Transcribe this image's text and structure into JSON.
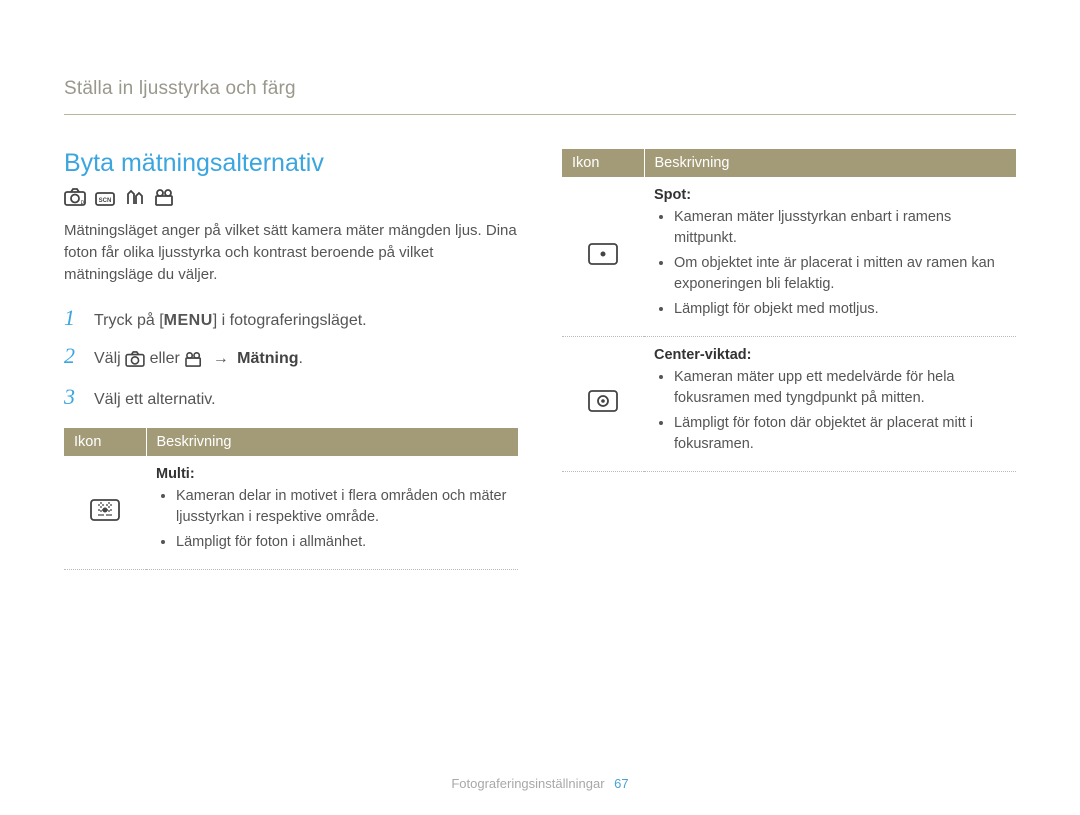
{
  "breadcrumb": "Ställa in ljusstyrka och färg",
  "title": "Byta mätningsalternativ",
  "intro": "Mätningsläget anger på vilket sätt kamera mäter mängden ljus. Dina foton får olika ljusstyrka och kontrast beroende på vilket mätningsläge du väljer.",
  "steps": {
    "s1_prefix": "Tryck på [",
    "s1_menu": "MENU",
    "s1_suffix": "] i fotograferingsläget.",
    "s2_prefix": "Välj ",
    "s2_mid": " eller ",
    "s2_arrow": "→",
    "s2_label": "Mätning",
    "s2_suffix": ".",
    "s3": "Välj ett alternativ."
  },
  "table": {
    "headers": {
      "icon": "Ikon",
      "desc": "Beskrivning"
    },
    "rows": {
      "multi": {
        "title": "Multi:",
        "points": [
          "Kameran delar in motivet i flera områden och mäter ljusstyrkan i respektive område.",
          "Lämpligt för foton i allmänhet."
        ]
      },
      "spot": {
        "title": "Spot:",
        "points": [
          "Kameran mäter ljusstyrkan enbart i ramens mittpunkt.",
          "Om objektet inte är placerat i mitten av ramen kan exponeringen bli felaktig.",
          "Lämpligt för objekt med motljus."
        ]
      },
      "center": {
        "title": "Center-viktad:",
        "points": [
          "Kameran mäter upp ett medelvärde för hela fokusramen med tyngdpunkt på mitten.",
          "Lämpligt för foton där objektet är placerat mitt i fokusramen."
        ]
      }
    }
  },
  "footer": {
    "section": "Fotograferingsinställningar",
    "page": "67"
  }
}
